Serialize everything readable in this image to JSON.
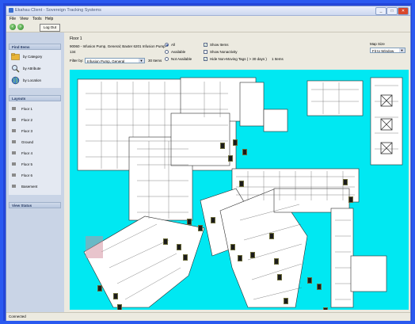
{
  "app": {
    "title": "Ekahau Client - Sovereign Tracking Systems"
  },
  "menu": [
    "File",
    "View",
    "Tools",
    "Help"
  ],
  "toolbar": {
    "logout_label": "Log Out"
  },
  "sidebar": {
    "find_section": "Find Items",
    "find_items": [
      {
        "label": "by Category",
        "icon": "folder-icon"
      },
      {
        "label": "by Attribute",
        "icon": "magnifier-icon"
      },
      {
        "label": "by Location",
        "icon": "globe-icon"
      }
    ],
    "layouts_section": "Layouts",
    "floors": [
      "Floor 1",
      "Floor 2",
      "Floor 3",
      "Ground",
      "Floor 4",
      "Floor 5",
      "Floor 6",
      "Basement"
    ],
    "view_section": "View Status"
  },
  "main": {
    "floor_label": "Floor 1",
    "item_description": "90060 - Infusion Pump, General; Baxter 6201 Infusion Pump",
    "item_count": "134",
    "filter_label": "Filter by:",
    "filter_value": "Infusion Pump, General",
    "filter_count": "30 Items",
    "radio_all": "All",
    "radio_available": "Available",
    "radio_not_available": "Not Available",
    "show_items": "Show Items",
    "show_nonactive": "Show Nonactivity",
    "hide_nonmoving": "Hide Non-Moving Tags ( > 30 days )",
    "nonmoving_count": "1 Items",
    "map_size_label": "Map Size",
    "map_size_value": "Fit to Window"
  },
  "status": {
    "text": "Connected"
  },
  "colors": {
    "accent": "#1a3ed8",
    "map_bg": "#00e8f2",
    "tag": "#1c1c1c"
  }
}
